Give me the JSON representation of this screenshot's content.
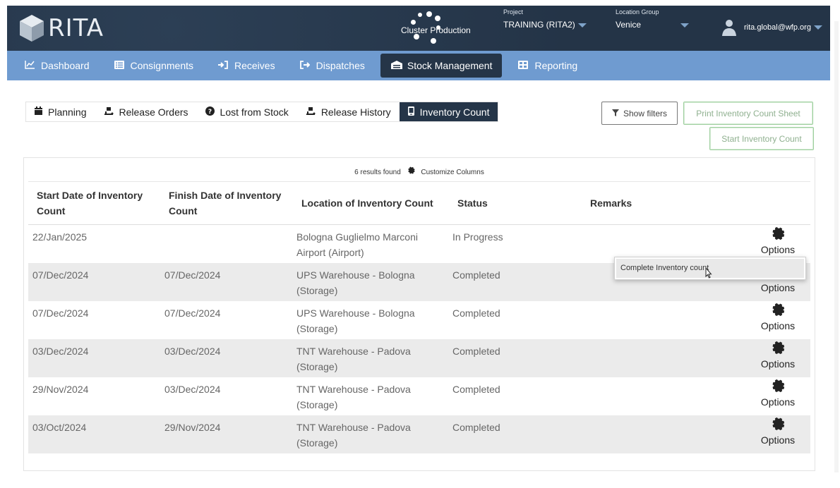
{
  "header": {
    "logo_text": "RITA",
    "cluster_label": "Cluster Production",
    "project_label": "Project",
    "project_value": "TRAINING (RITA2)",
    "location_group_label": "Location Group",
    "location_group_value": "Venice",
    "user_email": "rita.global@wfp.org"
  },
  "nav": [
    {
      "label": "Dashboard",
      "icon": "chart-line-icon"
    },
    {
      "label": "Consignments",
      "icon": "list-icon"
    },
    {
      "label": "Receives",
      "icon": "sign-in-icon"
    },
    {
      "label": "Dispatches",
      "icon": "sign-out-icon"
    },
    {
      "label": "Stock Management",
      "icon": "warehouse-icon",
      "active": true
    },
    {
      "label": "Reporting",
      "icon": "table-icon"
    }
  ],
  "subtabs": [
    {
      "label": "Planning",
      "icon": "calendar-icon"
    },
    {
      "label": "Release Orders",
      "icon": "dolly-icon"
    },
    {
      "label": "Lost from Stock",
      "icon": "question-circle-icon"
    },
    {
      "label": "Release History",
      "icon": "dolly-icon"
    },
    {
      "label": "Inventory Count",
      "icon": "mobile-icon",
      "active": true
    }
  ],
  "buttons": {
    "show_filters": "Show filters",
    "print_sheet": "Print Inventory Count Sheet",
    "start_count": "Start Inventory Count"
  },
  "table": {
    "results_text": "6 results found",
    "customize_columns": "Customize Columns",
    "headers": {
      "start": "Start Date of Inventory Count",
      "finish": "Finish Date of Inventory Count",
      "location": "Location of Inventory Count",
      "status": "Status",
      "remarks": "Remarks"
    },
    "options_label": "Options",
    "rows": [
      {
        "start": "22/Jan/2025",
        "finish": "",
        "location_1": "Bologna Guglielmo Marconi",
        "location_2": "Airport (Airport)",
        "status": "In Progress"
      },
      {
        "start": "07/Dec/2024",
        "finish": "07/Dec/2024",
        "location_1": "UPS Warehouse - Bologna",
        "location_2": "(Storage)",
        "status": "Completed"
      },
      {
        "start": "07/Dec/2024",
        "finish": "07/Dec/2024",
        "location_1": "UPS Warehouse - Bologna",
        "location_2": "(Storage)",
        "status": "Completed"
      },
      {
        "start": "03/Dec/2024",
        "finish": "03/Dec/2024",
        "location_1": "TNT Warehouse - Padova",
        "location_2": "(Storage)",
        "status": "Completed"
      },
      {
        "start": "29/Nov/2024",
        "finish": "03/Dec/2024",
        "location_1": "TNT Warehouse - Padova",
        "location_2": "(Storage)",
        "status": "Completed"
      },
      {
        "start": "03/Oct/2024",
        "finish": "29/Nov/2024",
        "location_1": "TNT Warehouse - Padova",
        "location_2": "(Storage)",
        "status": "Completed"
      }
    ]
  },
  "dropdown": {
    "item": "Complete Inventory count"
  },
  "colors": {
    "header_bg": "#243447",
    "nav_bg": "#6f9bd0",
    "active_bg": "#253548",
    "row_alt": "#ebebeb",
    "green_btn": "#9ecf9e"
  }
}
